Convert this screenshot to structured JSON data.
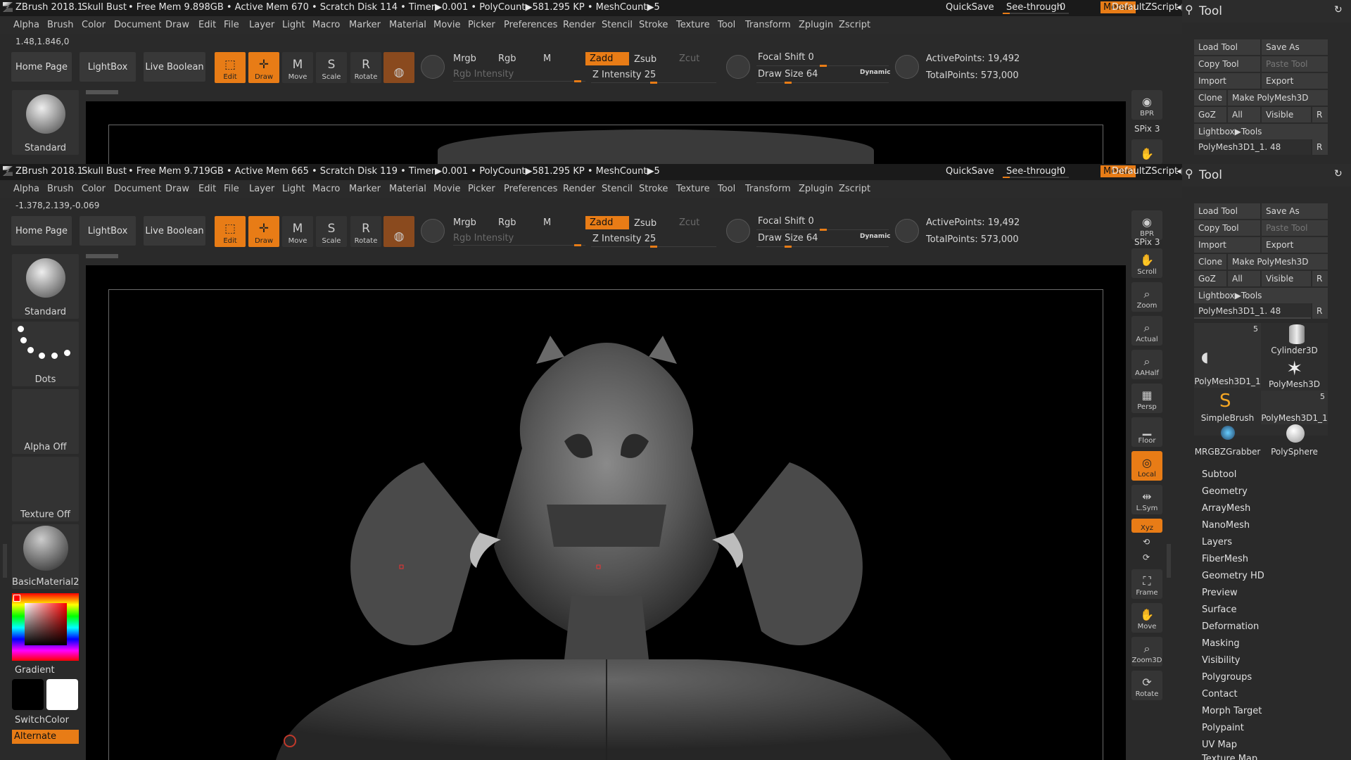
{
  "title_bar": {
    "app": "ZBrush 2018.1",
    "project": "Skull Bust",
    "stats_a": "• Free Mem 9.898GB • Active Mem 670 • Scratch Disk 114 • Timer▶0.001 • PolyCount▶581.295 KP • MeshCount▶5",
    "stats_b": "• Free Mem 9.719GB • Active Mem 665 • Scratch Disk 119 • Timer▶0.001 • PolyCount▶581.295 KP • MeshCount▶5",
    "quicksave": "QuickSave",
    "see_through": "See-through",
    "see_through_value": "0",
    "menus": "Menus",
    "script": "DefaultZScript"
  },
  "menu_bar": [
    "Alpha",
    "Brush",
    "Color",
    "Document",
    "Draw",
    "Edit",
    "File",
    "Layer",
    "Light",
    "Macro",
    "Marker",
    "Material",
    "Movie",
    "Picker",
    "Preferences",
    "Render",
    "Stencil",
    "Stroke",
    "Texture",
    "Tool",
    "Transform",
    "Zplugin",
    "Zscript"
  ],
  "coords_a": "1.48,1.846,0",
  "coords_b": "-1.378,2.139,-0.069",
  "shelf": {
    "home": "Home Page",
    "lightbox": "LightBox",
    "live_boolean": "Live Boolean",
    "tools": [
      {
        "label": "Edit",
        "glyph": "⬚"
      },
      {
        "label": "Draw",
        "glyph": "✛"
      },
      {
        "label": "Move",
        "glyph": "M"
      },
      {
        "label": "Scale",
        "glyph": "S"
      },
      {
        "label": "Rotate",
        "glyph": "R"
      }
    ],
    "mrgb": "Mrgb",
    "rgb": "Rgb",
    "m": "M",
    "rgb_intensity": "Rgb Intensity",
    "zadd": "Zadd",
    "zsub": "Zsub",
    "zcut": "Zcut",
    "z_intensity": "Z Intensity 25",
    "focal_shift": "Focal Shift 0",
    "draw_size": "Draw Size 64",
    "dynamic": "Dynamic",
    "active_points": "ActivePoints: 19,492",
    "total_points": "TotalPoints: 573,000"
  },
  "left_tray": {
    "brush": "Standard",
    "stroke": "Dots",
    "alpha": "Alpha Off",
    "texture": "Texture Off",
    "material": "BasicMaterial2",
    "gradient": "Gradient",
    "switch_color": "SwitchColor",
    "alternate": "Alternate"
  },
  "right_tray": [
    {
      "label": "BPR",
      "glyph": "◉"
    },
    {
      "label": "SPix 3",
      "glyph": ""
    },
    {
      "label": "Scroll",
      "glyph": "✋"
    },
    {
      "label": "Zoom",
      "glyph": "⌕"
    },
    {
      "label": "Actual",
      "glyph": "⌕"
    },
    {
      "label": "AAHalf",
      "glyph": "⌕"
    },
    {
      "label": "Persp",
      "glyph": "▦"
    },
    {
      "label": "Floor",
      "glyph": "▁"
    },
    {
      "label": "Local",
      "glyph": "◎"
    },
    {
      "label": "L.Sym",
      "glyph": "⇹"
    },
    {
      "label": "Xyz",
      "glyph": "✕"
    },
    {
      "label": "Frame",
      "glyph": "⛶"
    },
    {
      "label": "Move",
      "glyph": "✋"
    },
    {
      "label": "Zoom3D",
      "glyph": "⌕"
    },
    {
      "label": "Rotate",
      "glyph": "⟳"
    }
  ],
  "tool_panel": {
    "title": "Tool",
    "buttons": [
      [
        "Load Tool",
        "Save As"
      ],
      [
        "Copy Tool",
        "Paste Tool"
      ],
      [
        "Import",
        "Export"
      ],
      [
        "Clone",
        "Make PolyMesh3D"
      ],
      [
        "GoZ",
        "All",
        "Visible",
        "R"
      ]
    ],
    "lightbox_tools": "Lightbox▶Tools",
    "current_tool": "PolyMesh3D1_1. 48",
    "r": "R",
    "tools": [
      {
        "name": "PolyMesh3D1_1",
        "count": "5"
      },
      {
        "name": "Cylinder3D",
        "count": ""
      },
      {
        "name": "PolyMesh3D",
        "count": ""
      },
      {
        "name": "SimpleBrush",
        "count": ""
      },
      {
        "name": "PolyMesh3D1_1",
        "count": "5"
      },
      {
        "name": "MRGBZGrabber",
        "count": ""
      },
      {
        "name": "PolySphere",
        "count": ""
      }
    ],
    "sections": [
      "Subtool",
      "Geometry",
      "ArrayMesh",
      "NanoMesh",
      "Layers",
      "FiberMesh",
      "Geometry HD",
      "Preview",
      "Surface",
      "Deformation",
      "Masking",
      "Visibility",
      "Polygroups",
      "Contact",
      "Morph Target",
      "Polypaint",
      "UV Map",
      "Texture Map"
    ]
  },
  "colors": {
    "accent": "#e87c16",
    "bg": "#2a2a2a",
    "viewport": "#000000"
  }
}
